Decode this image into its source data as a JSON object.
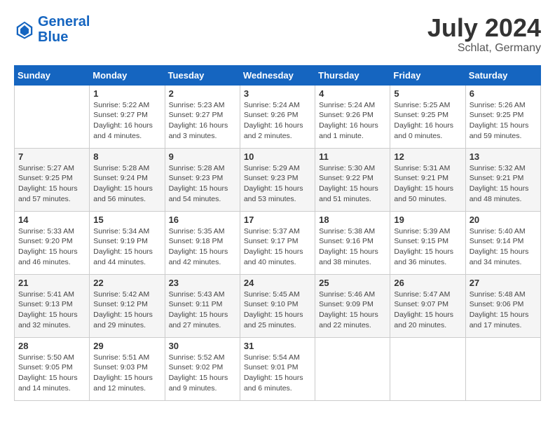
{
  "header": {
    "logo_line1": "General",
    "logo_line2": "Blue",
    "month": "July 2024",
    "location": "Schlat, Germany"
  },
  "columns": [
    "Sunday",
    "Monday",
    "Tuesday",
    "Wednesday",
    "Thursday",
    "Friday",
    "Saturday"
  ],
  "weeks": [
    [
      {
        "day": "",
        "info": ""
      },
      {
        "day": "1",
        "info": "Sunrise: 5:22 AM\nSunset: 9:27 PM\nDaylight: 16 hours\nand 4 minutes."
      },
      {
        "day": "2",
        "info": "Sunrise: 5:23 AM\nSunset: 9:27 PM\nDaylight: 16 hours\nand 3 minutes."
      },
      {
        "day": "3",
        "info": "Sunrise: 5:24 AM\nSunset: 9:26 PM\nDaylight: 16 hours\nand 2 minutes."
      },
      {
        "day": "4",
        "info": "Sunrise: 5:24 AM\nSunset: 9:26 PM\nDaylight: 16 hours\nand 1 minute."
      },
      {
        "day": "5",
        "info": "Sunrise: 5:25 AM\nSunset: 9:25 PM\nDaylight: 16 hours\nand 0 minutes."
      },
      {
        "day": "6",
        "info": "Sunrise: 5:26 AM\nSunset: 9:25 PM\nDaylight: 15 hours\nand 59 minutes."
      }
    ],
    [
      {
        "day": "7",
        "info": "Sunrise: 5:27 AM\nSunset: 9:25 PM\nDaylight: 15 hours\nand 57 minutes."
      },
      {
        "day": "8",
        "info": "Sunrise: 5:28 AM\nSunset: 9:24 PM\nDaylight: 15 hours\nand 56 minutes."
      },
      {
        "day": "9",
        "info": "Sunrise: 5:28 AM\nSunset: 9:23 PM\nDaylight: 15 hours\nand 54 minutes."
      },
      {
        "day": "10",
        "info": "Sunrise: 5:29 AM\nSunset: 9:23 PM\nDaylight: 15 hours\nand 53 minutes."
      },
      {
        "day": "11",
        "info": "Sunrise: 5:30 AM\nSunset: 9:22 PM\nDaylight: 15 hours\nand 51 minutes."
      },
      {
        "day": "12",
        "info": "Sunrise: 5:31 AM\nSunset: 9:21 PM\nDaylight: 15 hours\nand 50 minutes."
      },
      {
        "day": "13",
        "info": "Sunrise: 5:32 AM\nSunset: 9:21 PM\nDaylight: 15 hours\nand 48 minutes."
      }
    ],
    [
      {
        "day": "14",
        "info": "Sunrise: 5:33 AM\nSunset: 9:20 PM\nDaylight: 15 hours\nand 46 minutes."
      },
      {
        "day": "15",
        "info": "Sunrise: 5:34 AM\nSunset: 9:19 PM\nDaylight: 15 hours\nand 44 minutes."
      },
      {
        "day": "16",
        "info": "Sunrise: 5:35 AM\nSunset: 9:18 PM\nDaylight: 15 hours\nand 42 minutes."
      },
      {
        "day": "17",
        "info": "Sunrise: 5:37 AM\nSunset: 9:17 PM\nDaylight: 15 hours\nand 40 minutes."
      },
      {
        "day": "18",
        "info": "Sunrise: 5:38 AM\nSunset: 9:16 PM\nDaylight: 15 hours\nand 38 minutes."
      },
      {
        "day": "19",
        "info": "Sunrise: 5:39 AM\nSunset: 9:15 PM\nDaylight: 15 hours\nand 36 minutes."
      },
      {
        "day": "20",
        "info": "Sunrise: 5:40 AM\nSunset: 9:14 PM\nDaylight: 15 hours\nand 34 minutes."
      }
    ],
    [
      {
        "day": "21",
        "info": "Sunrise: 5:41 AM\nSunset: 9:13 PM\nDaylight: 15 hours\nand 32 minutes."
      },
      {
        "day": "22",
        "info": "Sunrise: 5:42 AM\nSunset: 9:12 PM\nDaylight: 15 hours\nand 29 minutes."
      },
      {
        "day": "23",
        "info": "Sunrise: 5:43 AM\nSunset: 9:11 PM\nDaylight: 15 hours\nand 27 minutes."
      },
      {
        "day": "24",
        "info": "Sunrise: 5:45 AM\nSunset: 9:10 PM\nDaylight: 15 hours\nand 25 minutes."
      },
      {
        "day": "25",
        "info": "Sunrise: 5:46 AM\nSunset: 9:09 PM\nDaylight: 15 hours\nand 22 minutes."
      },
      {
        "day": "26",
        "info": "Sunrise: 5:47 AM\nSunset: 9:07 PM\nDaylight: 15 hours\nand 20 minutes."
      },
      {
        "day": "27",
        "info": "Sunrise: 5:48 AM\nSunset: 9:06 PM\nDaylight: 15 hours\nand 17 minutes."
      }
    ],
    [
      {
        "day": "28",
        "info": "Sunrise: 5:50 AM\nSunset: 9:05 PM\nDaylight: 15 hours\nand 14 minutes."
      },
      {
        "day": "29",
        "info": "Sunrise: 5:51 AM\nSunset: 9:03 PM\nDaylight: 15 hours\nand 12 minutes."
      },
      {
        "day": "30",
        "info": "Sunrise: 5:52 AM\nSunset: 9:02 PM\nDaylight: 15 hours\nand 9 minutes."
      },
      {
        "day": "31",
        "info": "Sunrise: 5:54 AM\nSunset: 9:01 PM\nDaylight: 15 hours\nand 6 minutes."
      },
      {
        "day": "",
        "info": ""
      },
      {
        "day": "",
        "info": ""
      },
      {
        "day": "",
        "info": ""
      }
    ]
  ]
}
